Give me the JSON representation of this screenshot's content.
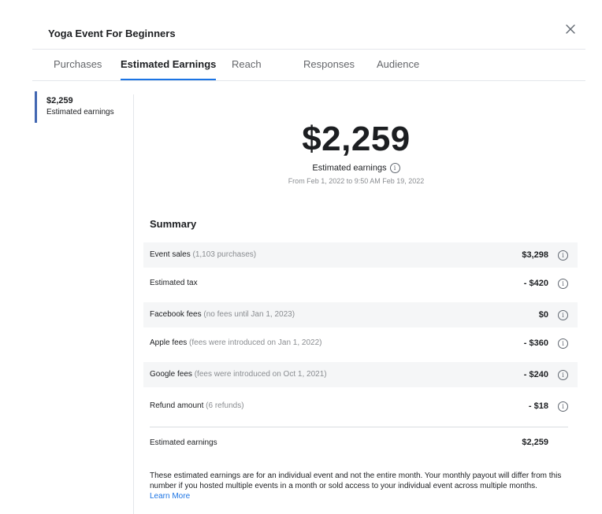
{
  "header": {
    "title": "Yoga Event For Beginners"
  },
  "tabs": [
    {
      "label": "Purchases"
    },
    {
      "label": "Estimated Earnings"
    },
    {
      "label": "Reach"
    },
    {
      "label": "Responses"
    },
    {
      "label": "Audience"
    }
  ],
  "active_tab": "Estimated Earnings",
  "sidebar": {
    "amount": "$2,259",
    "label": "Estimated earnings"
  },
  "hero": {
    "amount": "$2,259",
    "label": "Estimated earnings",
    "range": "From Feb 1, 2022 to 9:50 AM Feb 19, 2022"
  },
  "summary": {
    "title": "Summary",
    "rows": [
      {
        "label": "Event sales",
        "note": "(1,103 purchases)",
        "value": "$3,298"
      },
      {
        "label": "Estimated tax",
        "note": "",
        "value": "- $420"
      },
      {
        "label": "Facebook fees",
        "note": "(no fees until Jan 1, 2023)",
        "value": "$0"
      },
      {
        "label": "Apple fees",
        "note": "(fees were introduced on Jan 1, 2022)",
        "value": "- $360"
      },
      {
        "label": "Google fees",
        "note": "(fees were introduced on Oct 1, 2021)",
        "value": "- $240"
      },
      {
        "label": "Refund amount",
        "note": "(6 refunds)",
        "value": "- $18"
      }
    ],
    "total_label": "Estimated earnings",
    "total_value": "$2,259"
  },
  "disclaimer": {
    "text": "These estimated earnings are for an individual event and not the entire month. Your monthly payout will differ from this number if you hosted multiple events in a month or sold access to your individual event across multiple months.",
    "link": "Learn More"
  },
  "icons": {
    "close": "close-icon",
    "info": "info-icon"
  },
  "colors": {
    "accent": "#1b74e4",
    "sidebar_indicator": "#4267b2",
    "row_shade": "#f5f6f7"
  }
}
